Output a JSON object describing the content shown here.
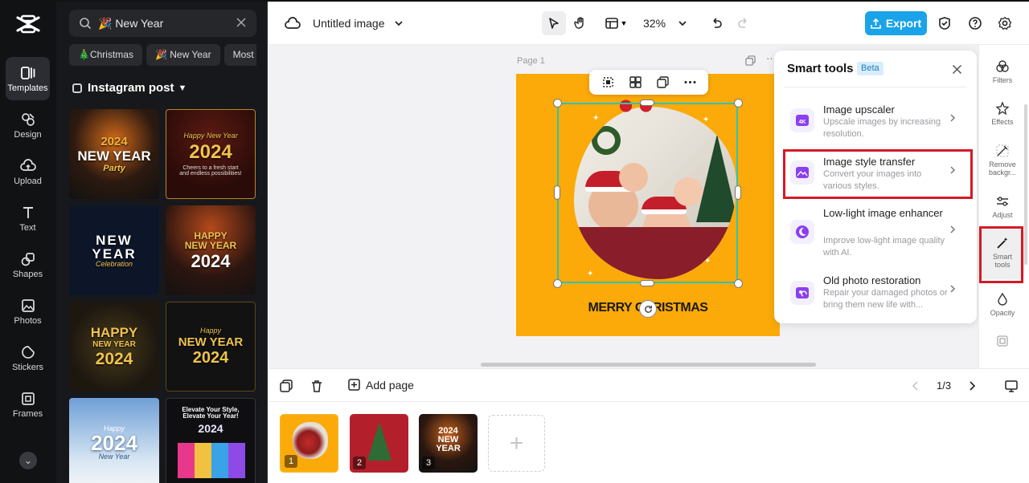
{
  "app": {
    "brand": "CapCut"
  },
  "left_rail": {
    "items": [
      {
        "label": "Templates",
        "icon": "templates-icon"
      },
      {
        "label": "Design",
        "icon": "design-icon"
      },
      {
        "label": "Upload",
        "icon": "upload-icon"
      },
      {
        "label": "Text",
        "icon": "text-icon"
      },
      {
        "label": "Shapes",
        "icon": "shapes-icon"
      },
      {
        "label": "Photos",
        "icon": "photos-icon"
      },
      {
        "label": "Stickers",
        "icon": "stickers-icon"
      },
      {
        "label": "Frames",
        "icon": "frames-icon"
      }
    ]
  },
  "search": {
    "value": "🎉 New Year"
  },
  "chips": [
    "🎄Christmas",
    "🎉 New Year",
    "Most"
  ],
  "section": {
    "title": "Instagram post"
  },
  "templates": [
    {
      "line1": "2024",
      "line2": "NEW YEAR",
      "line3": "Party"
    },
    {
      "line1": "Happy New Year",
      "line2": "2024",
      "line3": "Cheers to a fresh start and endless possibilities!"
    },
    {
      "line1": "NEW",
      "line2": "YEAR",
      "line3": "Celebration"
    },
    {
      "line1": "HAPPY",
      "line2": "NEW YEAR",
      "line3": "2024"
    },
    {
      "line1": "HAPPY",
      "line2": "NEW YEAR",
      "line3": "2024"
    },
    {
      "line1": "Happy",
      "line2": "NEW YEAR",
      "line3": "2024"
    },
    {
      "line1": "Happy",
      "line2": "2024",
      "line3": "New Year"
    },
    {
      "line1": "Elevate Your Style, Elevate Your Year!",
      "line2": "2024",
      "line3": ""
    }
  ],
  "topbar": {
    "title": "Untitled image",
    "zoom": "32%",
    "export_label": "Export"
  },
  "canvas": {
    "page_label": "Page 1",
    "caption": "MERRY CHRISTMAS"
  },
  "smart_tools": {
    "title": "Smart tools",
    "badge": "Beta",
    "items": [
      {
        "name": "Image upscaler",
        "desc": "Upscale images by increasing resolution."
      },
      {
        "name": "Image style transfer",
        "desc": "Convert your images into various styles."
      },
      {
        "name": "Low-light image enhancer",
        "desc": "Improve low-light image quality with AI."
      },
      {
        "name": "Old photo restoration",
        "desc": "Repair your damaged photos or bring them new life with..."
      }
    ]
  },
  "right_rail": {
    "items": [
      {
        "label": "Filters"
      },
      {
        "label": "Effects"
      },
      {
        "label": "Remove backgr..."
      },
      {
        "label": "Adjust"
      },
      {
        "label": "Smart tools"
      },
      {
        "label": "Opacity"
      }
    ]
  },
  "bottom": {
    "add_page_label": "Add page",
    "pager": "1/3",
    "pages": [
      "1",
      "2",
      "3"
    ]
  },
  "colors": {
    "accent": "#1aa3e8",
    "highlight": "#d51a26",
    "artboard": "#fbaa09"
  }
}
